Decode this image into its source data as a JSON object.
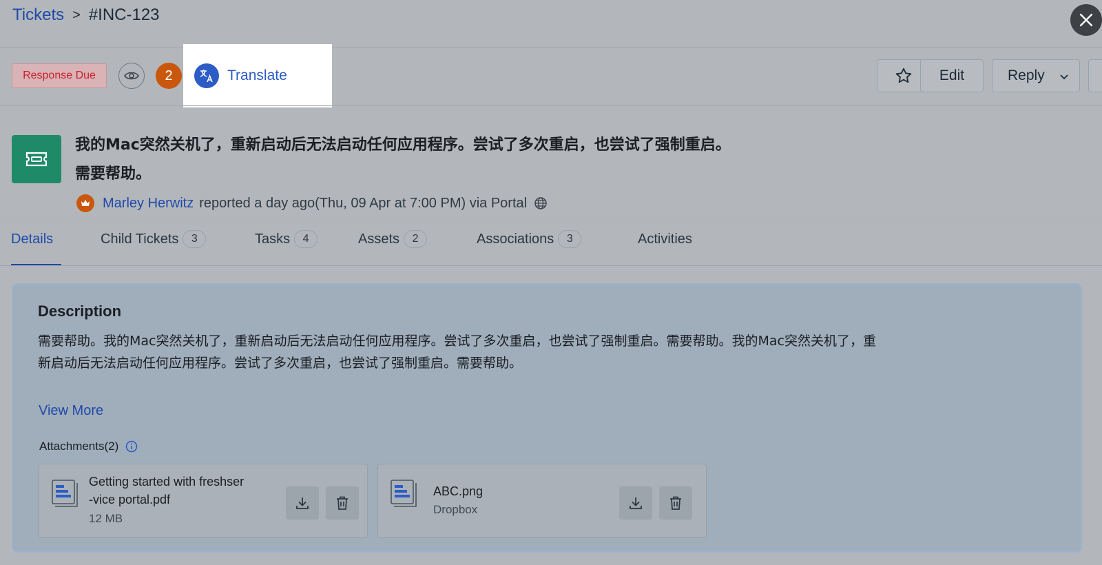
{
  "breadcrumb": {
    "root": "Tickets",
    "separator": ">",
    "current": "#INC-123"
  },
  "toolbar": {
    "response_badge": "Response Due",
    "watchers_count": "2",
    "translate_label": "Translate",
    "edit_label": "Edit",
    "reply_label": "Reply"
  },
  "ticket": {
    "subject_line1": "我的Mac突然关机了，重新启动后无法启动任何应用程序。尝试了多次重启，也尝试了强制重启。",
    "subject_line2": "需要帮助。",
    "reporter": "Marley Herwitz",
    "reported_text": "reported a day ago(Thu, 09 Apr at 7:00 PM) via Portal"
  },
  "tabs": [
    {
      "label": "Details",
      "count": null
    },
    {
      "label": "Child Tickets",
      "count": "3"
    },
    {
      "label": "Tasks",
      "count": "4"
    },
    {
      "label": "Assets",
      "count": "2"
    },
    {
      "label": "Associations",
      "count": "3"
    },
    {
      "label": "Activities",
      "count": null
    }
  ],
  "description": {
    "title": "Description",
    "line1": "需要帮助。我的Mac突然关机了，重新启动后无法启动任何应用程序。尝试了多次重启，也尝试了强制重启。需要帮助。我的Mac突然关机了，重",
    "line2": "新启动后无法启动任何应用程序。尝试了多次重启，也尝试了强制重启。需要帮助。",
    "view_more": "View More",
    "attachments_label": "Attachments(2)"
  },
  "attachments": [
    {
      "name_line1": "Getting started with freshser",
      "name_line2": "-vice portal.pdf",
      "meta": "12 MB"
    },
    {
      "name_line1": "ABC.png",
      "name_line2": "",
      "meta": "Dropbox"
    }
  ],
  "colors": {
    "accent": "#2c5cc5",
    "ticket_icon": "#1f8a67",
    "watch_badge": "#c9570d",
    "due_text": "#c8202e"
  }
}
